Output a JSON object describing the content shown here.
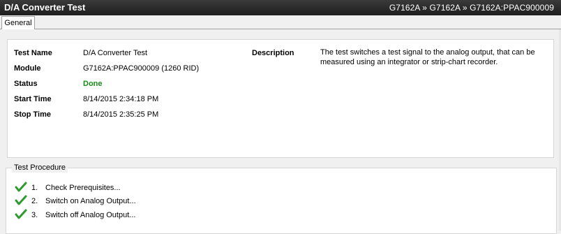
{
  "window": {
    "title": "D/A Converter Test",
    "breadcrumb": "G7162A » G7162A » G7162A:PPAC900009"
  },
  "tabs": [
    {
      "label": "General"
    }
  ],
  "details": {
    "test_name_label": "Test Name",
    "test_name": "D/A Converter Test",
    "module_label": "Module",
    "module": "G7162A:PPAC900009 (1260 RID)",
    "status_label": "Status",
    "status": "Done",
    "status_color": "#1a8a1a",
    "start_label": "Start Time",
    "start_time": "8/14/2015 2:34:18 PM",
    "stop_label": "Stop Time",
    "stop_time": "8/14/2015 2:35:25 PM",
    "description_label": "Description",
    "description": "The test switches a test signal to the analog output, that can be measured using an integrator or strip-chart recorder."
  },
  "procedure": {
    "title": "Test Procedure",
    "steps": [
      {
        "number": "1.",
        "label": "Check Prerequisites...",
        "icon": "checkmark-icon"
      },
      {
        "number": "2.",
        "label": "Switch on Analog Output...",
        "icon": "checkmark-icon"
      },
      {
        "number": "3.",
        "label": "Switch off Analog Output...",
        "icon": "checkmark-icon"
      }
    ]
  }
}
